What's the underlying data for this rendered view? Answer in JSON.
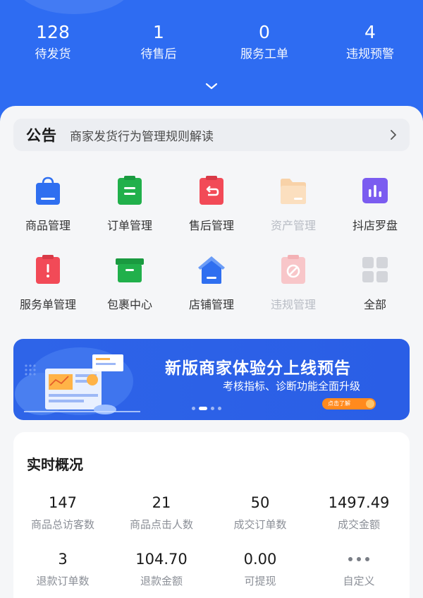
{
  "header": {
    "stats": [
      {
        "value": "128",
        "label": "待发货"
      },
      {
        "value": "1",
        "label": "待售后"
      },
      {
        "value": "0",
        "label": "服务工单"
      },
      {
        "value": "4",
        "label": "违规预警"
      }
    ]
  },
  "notice": {
    "tag": "公告",
    "text": "商家发货行为管理规则解读"
  },
  "menu": [
    {
      "label": "商品管理",
      "icon": "bag-icon",
      "color": "#2f6ff0"
    },
    {
      "label": "订单管理",
      "icon": "clipboard-icon",
      "color": "#21b04b"
    },
    {
      "label": "售后管理",
      "icon": "return-icon",
      "color": "#f24a57"
    },
    {
      "label": "资产管理",
      "icon": "folder-icon",
      "color": "#f8d2a8"
    },
    {
      "label": "抖店罗盘",
      "icon": "chart-icon",
      "color": "#7b5cf0"
    },
    {
      "label": "服务单管理",
      "icon": "alert-icon",
      "color": "#f24a57"
    },
    {
      "label": "包裹中心",
      "icon": "box-icon",
      "color": "#21b04b"
    },
    {
      "label": "店铺管理",
      "icon": "home-icon",
      "color": "#2f6ff0"
    },
    {
      "label": "违规管理",
      "icon": "ban-icon",
      "color": "#f8c6c9"
    },
    {
      "label": "全部",
      "icon": "grid-icon",
      "color": "#c9ccd2"
    }
  ],
  "banner": {
    "title": "新版商家体验分上线预告",
    "subtitle": "考核指标、诊断功能全面升级",
    "button": "点击了解"
  },
  "overview": {
    "title": "实时概况",
    "metrics": [
      {
        "value": "147",
        "label": "商品总访客数"
      },
      {
        "value": "21",
        "label": "商品点击人数"
      },
      {
        "value": "50",
        "label": "成交订单数"
      },
      {
        "value": "1497.49",
        "label": "成交金额"
      },
      {
        "value": "3",
        "label": "退款订单数"
      },
      {
        "value": "104.70",
        "label": "退款金额"
      },
      {
        "value": "0.00",
        "label": "可提现"
      },
      {
        "label": "自定义"
      }
    ]
  }
}
